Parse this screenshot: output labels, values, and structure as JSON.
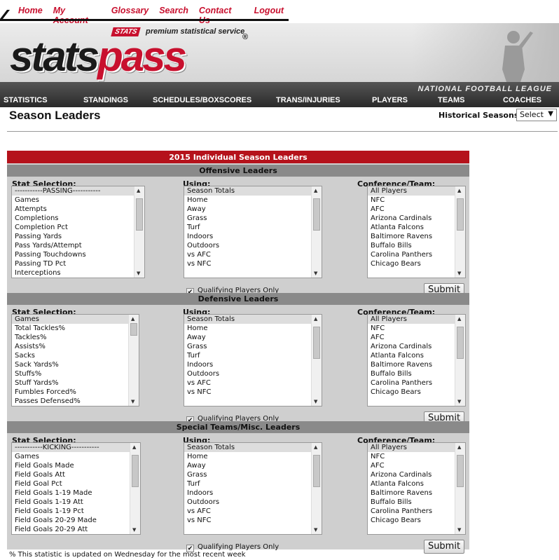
{
  "topnav": [
    "Home",
    "My Account",
    "Glossary",
    "Search",
    "Contact Us",
    "Logout"
  ],
  "banner": {
    "logo_part1": "stats",
    "logo_part2": "pass",
    "badge": "STATS",
    "tagline": "premium statistical service",
    "reg": "®"
  },
  "mainnav": {
    "league": "NATIONAL FOOTBALL LEAGUE",
    "tabs": [
      "STATISTICS",
      "STANDINGS",
      "SCHEDULES/BOXSCORES",
      "TRANS/INJURIES",
      "PLAYERS",
      "TEAMS",
      "COACHES"
    ]
  },
  "page": {
    "title": "Season Leaders",
    "historical_label": "Historical Seasons:",
    "historical_value": "Select"
  },
  "panel_title": "2015 Individual Season Leaders",
  "labels": {
    "stat_selection": "Stat Selection:",
    "using": "Using:",
    "conference_team": "Conference/Team:",
    "qualifying": "Qualifying Players Only",
    "submit": "Submit"
  },
  "sections": [
    {
      "name": "Offensive Leaders",
      "stats": [
        "-----------PASSING-----------",
        "Games",
        "Attempts",
        "Completions",
        "Completion Pct",
        "Passing Yards",
        "Pass Yards/Attempt",
        "Passing Touchdowns",
        "Passing TD Pct",
        "Interceptions"
      ]
    },
    {
      "name": "Defensive Leaders",
      "stats": [
        "Games",
        "Total Tackles%",
        "Tackles%",
        "Assists%",
        "Sacks",
        "Sack Yards%",
        "Stuffs%",
        "Stuff Yards%",
        "Fumbles Forced%",
        "Passes Defensed%"
      ]
    },
    {
      "name": "Special Teams/Misc. Leaders",
      "stats": [
        "-----------KICKING-----------",
        "Games",
        "Field Goals Made",
        "Field Goals Att",
        "Field Goal Pct",
        "Field Goals 1-19 Made",
        "Field Goals 1-19 Att",
        "Field Goals 1-19 Pct",
        "Field Goals 20-29 Made",
        "Field Goals 20-29 Att"
      ]
    }
  ],
  "using_options": [
    "Season Totals",
    "Home",
    "Away",
    "Grass",
    "Turf",
    "Indoors",
    "Outdoors",
    "vs AFC",
    "vs NFC"
  ],
  "team_options": [
    "All Players",
    "NFC",
    "AFC",
    "Arizona Cardinals",
    "Atlanta Falcons",
    "Baltimore Ravens",
    "Buffalo Bills",
    "Carolina Panthers",
    "Chicago Bears"
  ],
  "footnote": "% This statistic is updated on Wednesday for the most recent week"
}
